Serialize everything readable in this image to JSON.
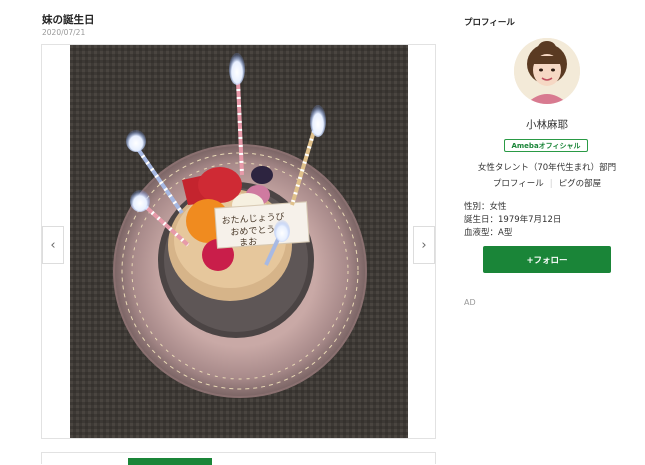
{
  "post": {
    "title": "妹の誕生日",
    "date": "2020/07/21"
  },
  "gallery": {
    "prev_icon": "chevron-left-icon",
    "next_icon": "chevron-right-icon",
    "prev_glyph": "‹",
    "next_glyph": "›",
    "photo_subject": "birthday-cake-photo",
    "plate_message": [
      "おたんじょうび",
      "おめでとう",
      "まお"
    ]
  },
  "sidebar": {
    "heading": "プロフィール",
    "name": "小林麻耶",
    "badge": "Amebaオフィシャル",
    "category": "女性タレント（70年代生まれ）部門",
    "links": {
      "profile": "プロフィール",
      "room": "ピグの部屋"
    },
    "gender": "性別：女性",
    "birthday": "誕生日：1979年7月12日",
    "blood_type": "血液型：A型",
    "follow_label": "+フォロー",
    "ad_label": "AD"
  },
  "colors": {
    "brand_green": "#1a8538",
    "text": "#333333",
    "muted": "#999999"
  }
}
